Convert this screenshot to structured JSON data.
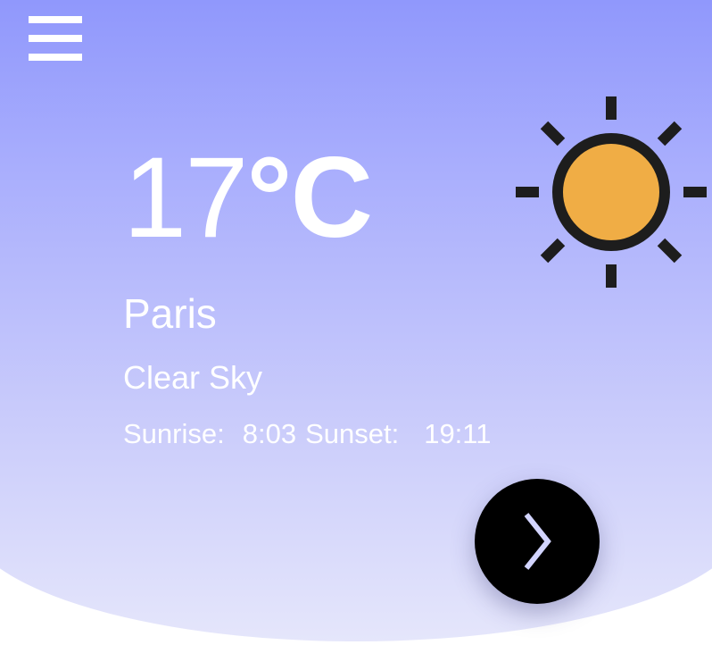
{
  "weather": {
    "temperature": "17",
    "unit": "°C",
    "city": "Paris",
    "condition": "Clear Sky",
    "sunrise_label": "Sunrise:",
    "sunrise_time": "8:03",
    "sunset_label": "Sunset:",
    "sunset_time": "19:11"
  },
  "icons": {
    "menu": "hamburger-menu-icon",
    "weather": "sun-icon",
    "next": "chevron-right-icon"
  },
  "colors": {
    "background_top": "#8e96fc",
    "background_bottom": "#e5e6fb",
    "sun_fill": "#f0ad45",
    "sun_outline": "#1d1d1d",
    "next_button": "#000000",
    "chevron": "#d2d4ff"
  }
}
